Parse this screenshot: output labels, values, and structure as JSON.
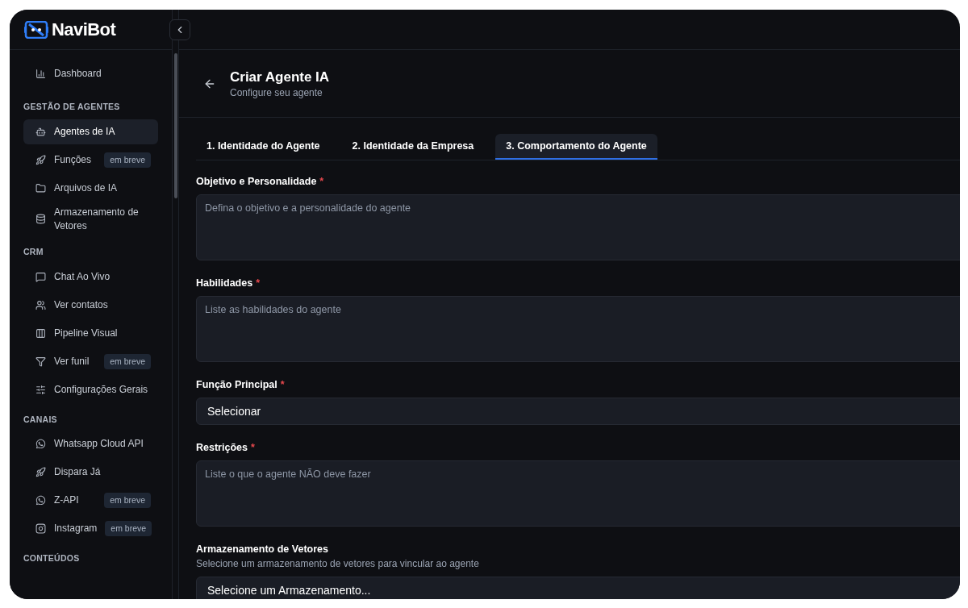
{
  "brand": "NaviBot",
  "sidebar": {
    "top_items": [
      {
        "label": "Dashboard",
        "selected": false
      }
    ],
    "sections": [
      {
        "title": "GESTÃO DE AGENTES",
        "items": [
          {
            "label": "Agentes de IA",
            "selected": true
          },
          {
            "label": "Funções",
            "selected": false,
            "badge": "em breve"
          },
          {
            "label": "Arquivos de IA",
            "selected": false
          },
          {
            "label": "Armazenamento de Vetores",
            "selected": false
          }
        ]
      },
      {
        "title": "CRM",
        "items": [
          {
            "label": "Chat Ao Vivo",
            "selected": false
          },
          {
            "label": "Ver contatos",
            "selected": false
          },
          {
            "label": "Pipeline Visual",
            "selected": false
          },
          {
            "label": "Ver funil",
            "selected": false,
            "badge": "em breve"
          },
          {
            "label": "Configurações Gerais",
            "selected": false
          }
        ]
      },
      {
        "title": "CANAIS",
        "items": [
          {
            "label": "Whatsapp Cloud API",
            "selected": false
          },
          {
            "label": "Dispara Já",
            "selected": false
          },
          {
            "label": "Z-API",
            "selected": false,
            "badge": "em breve"
          },
          {
            "label": "Instagram",
            "selected": false,
            "badge": "em breve"
          }
        ]
      },
      {
        "title": "CONTEÚDOS"
      }
    ]
  },
  "page": {
    "title": "Criar Agente IA",
    "subtitle": "Configure seu agente"
  },
  "tabs": [
    {
      "label": "1. Identidade do Agente",
      "selected": false
    },
    {
      "label": "2. Identidade da Empresa",
      "selected": false
    },
    {
      "label": "3. Comportamento do Agente",
      "selected": true
    }
  ],
  "fields": [
    {
      "kind": "textarea",
      "label": "Objetivo e Personalidade",
      "required_mark": "*",
      "placeholder": "Defina o objetivo e a personalidade do agente"
    },
    {
      "kind": "textarea",
      "label": "Habilidades",
      "required_mark": "*",
      "placeholder": "Liste as habilidades do agente"
    },
    {
      "kind": "select",
      "label": "Função Principal",
      "required_mark": "*",
      "value": "Selecionar"
    },
    {
      "kind": "textarea",
      "label": "Restrições",
      "required_mark": "*",
      "placeholder": "Liste o que o agente NÃO deve fazer"
    },
    {
      "kind": "select",
      "label": "Armazenamento de Vetores",
      "description": "Selecione um armazenamento de vetores para vincular ao agente",
      "value": "Selecione um Armazenamento..."
    }
  ]
}
